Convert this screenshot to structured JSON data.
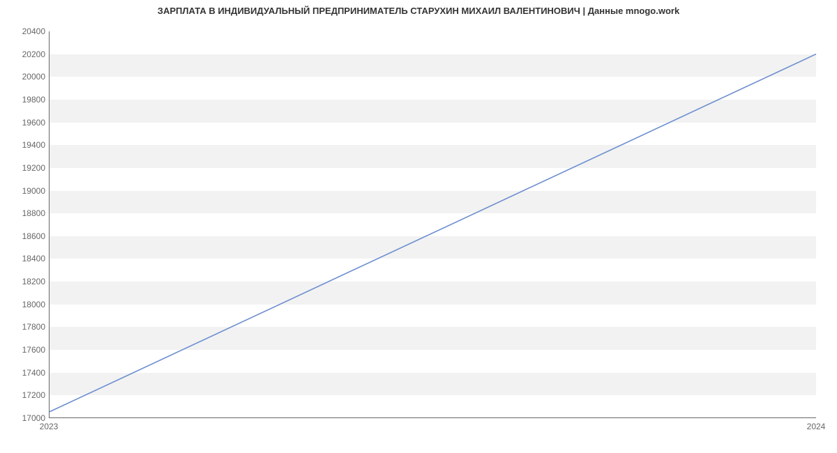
{
  "chart_data": {
    "type": "line",
    "title": "ЗАРПЛАТА В ИНДИВИДУАЛЬНЫЙ ПРЕДПРИНИМАТЕЛЬ СТАРУХИН МИХАИЛ ВАЛЕНТИНОВИЧ | Данные mnogo.work",
    "xlabel": "",
    "ylabel": "",
    "x_ticks": [
      "2023",
      "2024"
    ],
    "y_ticks": [
      17000,
      17200,
      17400,
      17600,
      17800,
      18000,
      18200,
      18400,
      18600,
      18800,
      19000,
      19200,
      19400,
      19600,
      19800,
      20000,
      20200,
      20400
    ],
    "ylim": [
      17000,
      20400
    ],
    "series": [
      {
        "name": "salary",
        "color": "#6b8ecf",
        "x": [
          "2023",
          "2024"
        ],
        "values": [
          17050,
          20200
        ]
      }
    ]
  }
}
